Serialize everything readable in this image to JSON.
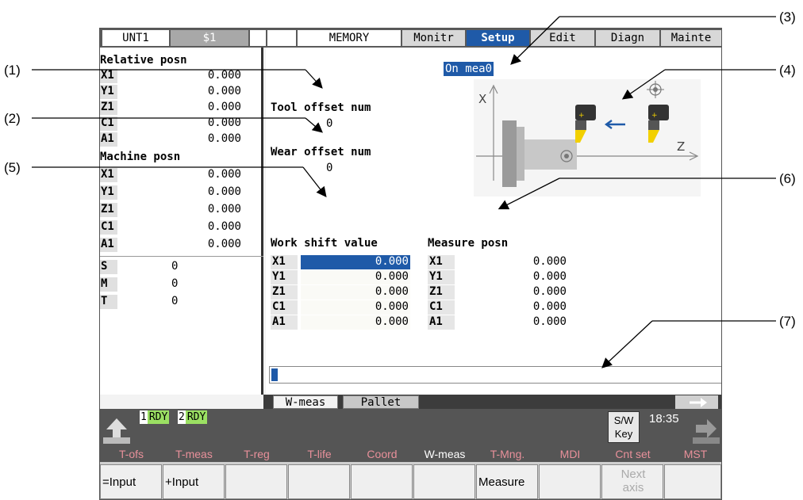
{
  "callouts": [
    "(1)",
    "(2)",
    "(3)",
    "(4)",
    "(5)",
    "(6)",
    "(7)"
  ],
  "topbar": {
    "unit": "UNT1",
    "system": "$1",
    "mode": "MEMORY",
    "tabs": [
      "Monitr",
      "Setup",
      "Edit",
      "Diagn",
      "Mainte"
    ],
    "active_tab": "Setup"
  },
  "left": {
    "relative_title": "Relative posn",
    "relative": [
      {
        "axis": "X1",
        "value": "0.000"
      },
      {
        "axis": "Y1",
        "value": "0.000"
      },
      {
        "axis": "Z1",
        "value": "0.000"
      },
      {
        "axis": "C1",
        "value": "0.000"
      },
      {
        "axis": "A1",
        "value": "0.000"
      }
    ],
    "machine_title": "Machine posn",
    "machine": [
      {
        "axis": "X1",
        "value": "0.000"
      },
      {
        "axis": "Y1",
        "value": "0.000"
      },
      {
        "axis": "Z1",
        "value": "0.000"
      },
      {
        "axis": "C1",
        "value": "0.000"
      },
      {
        "axis": "A1",
        "value": "0.000"
      }
    ],
    "smt": [
      {
        "axis": "S",
        "value": "0"
      },
      {
        "axis": "M",
        "value": "0"
      },
      {
        "axis": "T",
        "value": "0"
      }
    ]
  },
  "main": {
    "on_meas": "On mea0",
    "tool_offset_label": "Tool offset num",
    "tool_offset_value": "0",
    "wear_offset_label": "Wear offset num",
    "wear_offset_value": "0",
    "diagram": {
      "x_label": "X",
      "z_label": "Z"
    },
    "work_shift_title": "Work shift value",
    "work_shift": [
      {
        "axis": "X1",
        "value": "0.000"
      },
      {
        "axis": "Y1",
        "value": "0.000"
      },
      {
        "axis": "Z1",
        "value": "0.000"
      },
      {
        "axis": "C1",
        "value": "0.000"
      },
      {
        "axis": "A1",
        "value": "0.000"
      }
    ],
    "measure_title": "Measure posn",
    "measure": [
      {
        "axis": "X1",
        "value": "0.000"
      },
      {
        "axis": "Y1",
        "value": "0.000"
      },
      {
        "axis": "Z1",
        "value": "0.000"
      },
      {
        "axis": "C1",
        "value": "0.000"
      },
      {
        "axis": "A1",
        "value": "0.000"
      }
    ],
    "input_value": ""
  },
  "subtabs": [
    "W-meas",
    "Pallet"
  ],
  "status": {
    "rdy1_num": "1",
    "rdy1_label": "RDY",
    "rdy2_num": "2",
    "rdy2_label": "RDY",
    "sw_line1": "S/W",
    "sw_line2": "Key",
    "clock": "18:35"
  },
  "fkeys": [
    "T-ofs",
    "T-meas",
    "T-reg",
    "T-life",
    "Coord",
    "W-meas",
    "T-Mng.",
    "MDI",
    "Cnt set",
    "MST"
  ],
  "softkeys": {
    "k1": "=Input",
    "k2": "+Input",
    "k3": "",
    "k4": "",
    "k5": "",
    "k6": "",
    "k7": "Measure",
    "k8": "",
    "k9_line1": "Next",
    "k9_line2": "axis",
    "k10": ""
  },
  "colors": {
    "accent": "#1f5aa8",
    "rdy": "#9be063",
    "fkey": "#e8909a"
  }
}
